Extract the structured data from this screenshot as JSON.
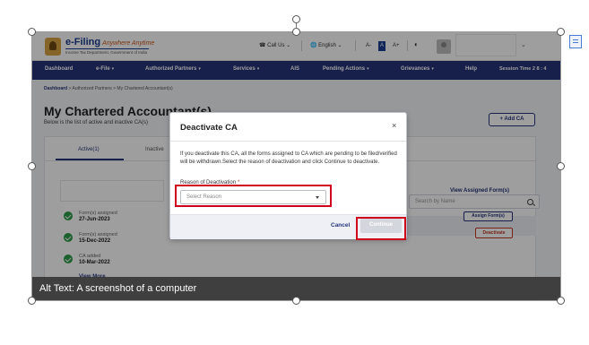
{
  "header": {
    "brand_name": "e-Filing",
    "brand_tagline": "Anywhere Anytime",
    "brand_subtitle": "Income Tax Department, Government of India",
    "call_us": "Call Us",
    "language": "English",
    "font_decrease": "A-",
    "font_normal": "A",
    "font_increase": "A+"
  },
  "nav": {
    "items": [
      "Dashboard",
      "e-File",
      "Authorized Partners",
      "Services",
      "AIS",
      "Pending Actions",
      "Grievances",
      "Help"
    ],
    "session_label": "Session Time",
    "session_value": "2 8 : 4"
  },
  "page": {
    "breadcrumb_root": "Dashboard",
    "breadcrumb_rest": "> Authorized Partners > My Chartered Accountant(s)",
    "title": "My Chartered Accountant(s)",
    "subtitle": "Below is the list of active and inactive CA(s)",
    "add_ca_label": "+ Add CA",
    "tab_active": "Active(1)",
    "tab_inactive": "Inactive",
    "search_placeholder": "Search by Name",
    "view_assigned": "View Assigned Form(s)",
    "assign_form": "Assign Form(s)",
    "deactivate": "Deactivate",
    "view_more": "View More",
    "timeline": [
      {
        "label": "Form(s) assigned",
        "date": "27-Jun-2023"
      },
      {
        "label": "Form(s) assigned",
        "date": "15-Dec-2022"
      },
      {
        "label": "CA added",
        "date": "10-Mar-2022"
      }
    ]
  },
  "modal": {
    "title": "Deactivate CA",
    "close_symbol": "×",
    "body": "If you deactivate this CA, all the forms assigned to CA which are pending to be filed/verified will be withdrawn.Select the reason of deactivation and click Continue to deactivate.",
    "field_label": "Reason of Deactivation",
    "required_mark": "*",
    "select_placeholder": "Select Reason",
    "cancel_label": "Cancel",
    "continue_label": "Continue"
  },
  "alt_text": "Alt Text: A screenshot of a computer",
  "colors": {
    "nav_blue": "#26357a",
    "highlight_red": "#d0021b",
    "success_green": "#2e9b47",
    "danger_red": "#c0392b"
  }
}
